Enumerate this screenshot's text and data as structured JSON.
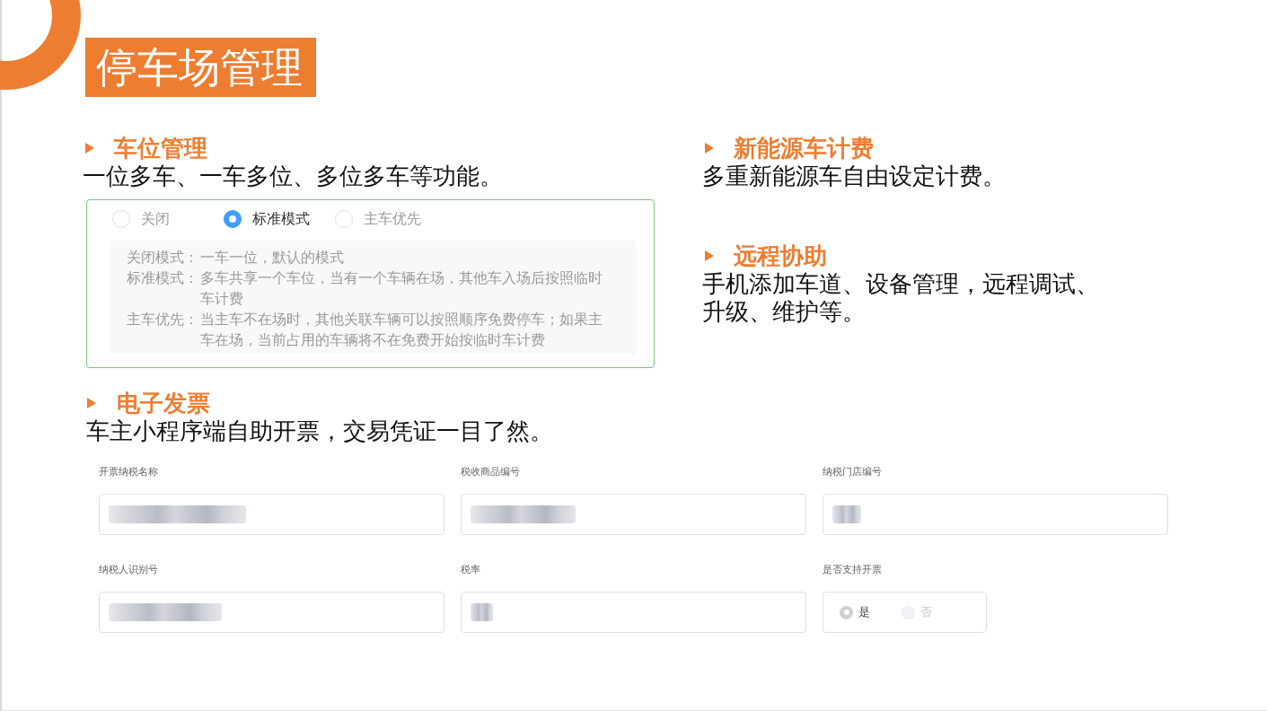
{
  "title": "停车场管理",
  "left_features": [
    {
      "heading": "车位管理",
      "description": "一位多车、一车多位、多位多车等功能。",
      "parking_mode_panel": {
        "options": [
          {
            "label": "关闭",
            "selected": false
          },
          {
            "label": "标准模式",
            "selected": true
          },
          {
            "label": "主车优先",
            "selected": false
          }
        ],
        "explanations": [
          {
            "term": "关闭模式：",
            "text": "一车一位，默认的模式"
          },
          {
            "term": "标准模式：",
            "text": "多车共享一个车位，当有一个车辆在场，其他车入场后按照临时车计费"
          },
          {
            "term": "主车优先：",
            "text": "当主车不在场时，其他关联车辆可以按照顺序免费停车；如果主车在场，当前占用的车辆将不在免费开始按临时车计费"
          }
        ]
      }
    }
  ],
  "right_features": [
    {
      "heading": "新能源车计费",
      "description": "多重新能源车自由设定计费。"
    },
    {
      "heading": "远程协助",
      "description": "手机添加车道、设备管理，远程调试、升级、维护等。"
    }
  ],
  "bottom_feature": {
    "heading": "电子发票",
    "description": "车主小程序端自助开票，交易凭证一目了然。",
    "invoice_form": {
      "fields": [
        {
          "kind": "input",
          "label": "开票纳税名称",
          "value_blurred": true
        },
        {
          "kind": "input",
          "label": "税收商品编号",
          "value_blurred": true
        },
        {
          "kind": "input",
          "label": "纳税门店编号",
          "value_blurred": true
        },
        {
          "kind": "input",
          "label": "纳税人识别号",
          "value_blurred": true
        },
        {
          "kind": "input",
          "label": "税率",
          "value_blurred": true
        },
        {
          "kind": "radio",
          "label": "是否支持开票",
          "disabled": true,
          "options": [
            {
              "label": "是",
              "selected": true
            },
            {
              "label": "否",
              "selected": false
            }
          ]
        }
      ]
    }
  }
}
